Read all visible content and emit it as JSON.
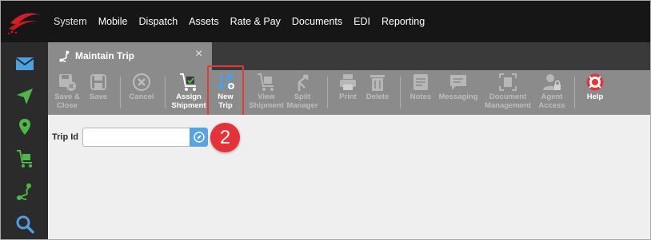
{
  "main_menu": [
    "System",
    "Mobile",
    "Dispatch",
    "Assets",
    "Rate & Pay",
    "Documents",
    "EDI",
    "Reporting"
  ],
  "sidebar": {
    "items": [
      {
        "name": "mail-icon"
      },
      {
        "name": "navigation-arrow-icon"
      },
      {
        "name": "map-pin-icon"
      },
      {
        "name": "shipment-cart-icon"
      },
      {
        "name": "trip-route-icon"
      },
      {
        "name": "search-icon"
      }
    ]
  },
  "tab": {
    "title": "Maintain Trip",
    "close": "×"
  },
  "toolbar": {
    "save_close": "Save &\nClose",
    "save": "Save",
    "cancel": "Cancel",
    "assign_shipment": "Assign\nShipment",
    "new_trip": "New\nTrip",
    "view_shipment": "View\nShipment",
    "split_manager": "Split\nManager",
    "print": "Print",
    "delete": "Delete",
    "notes": "Notes",
    "messaging": "Messaging",
    "document_management": "Document\nManagement",
    "agent_access": "Agent\nAccess",
    "help": "Help"
  },
  "form": {
    "trip_id_label": "Trip Id",
    "trip_id_value": ""
  },
  "annotation": {
    "step": "2"
  },
  "colors": {
    "accent_blue": "#58a4e0",
    "highlight_red": "#e2393c",
    "badge_red": "#e53137",
    "toolbar_gray": "#8b8b8b",
    "topbar": "#161616",
    "sidebar": "#2b2b2b"
  }
}
